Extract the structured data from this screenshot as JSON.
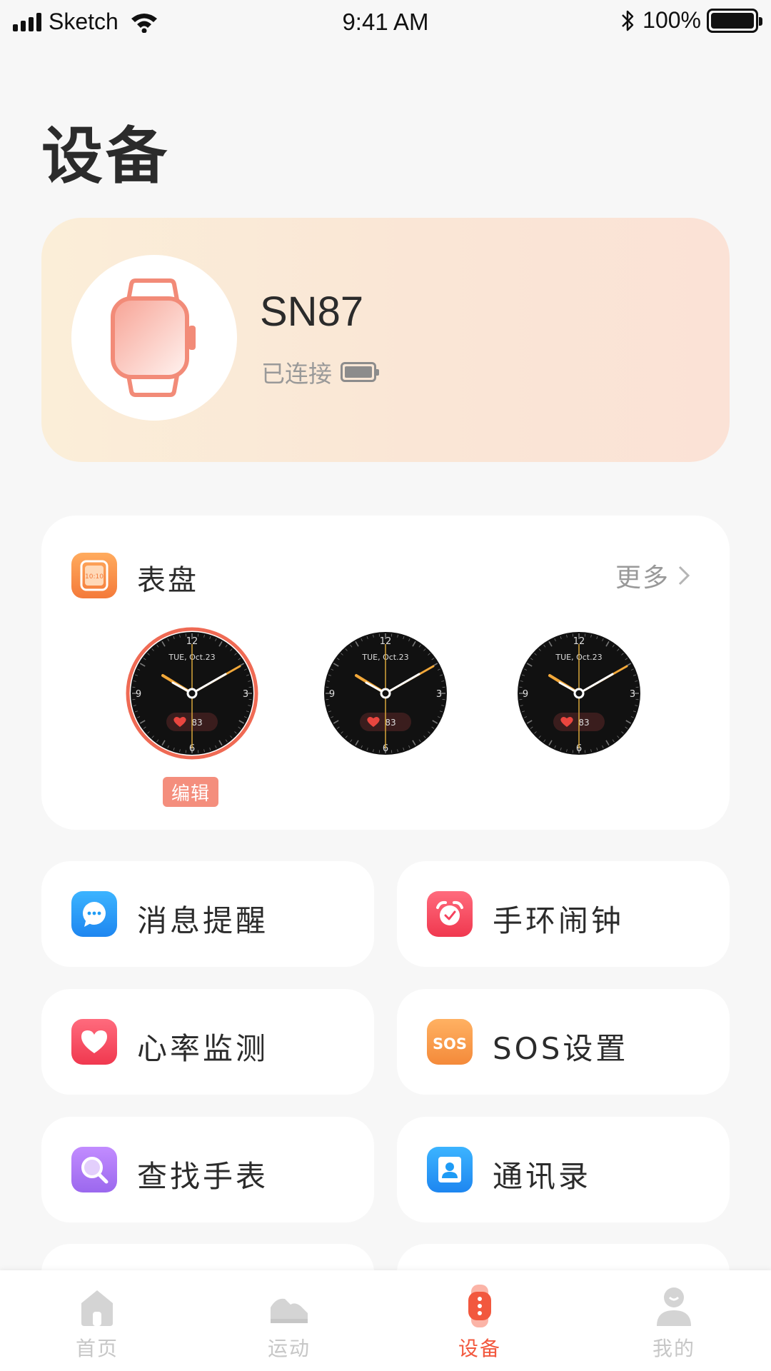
{
  "status_bar": {
    "carrier": "Sketch",
    "time": "9:41 AM",
    "battery_percent": "100%"
  },
  "page": {
    "title": "设备"
  },
  "device": {
    "name": "SN87",
    "status": "已连接",
    "battery_level": 1.0
  },
  "watch_faces": {
    "title": "表盘",
    "more_label": "更多",
    "edit_label": "编辑",
    "faces": [
      {
        "date": "TUE, Oct.23",
        "heart_rate": "83",
        "n12": "12",
        "n3": "3",
        "n6": "6",
        "n9": "9",
        "selected": true
      },
      {
        "date": "TUE, Oct.23",
        "heart_rate": "83",
        "n12": "12",
        "n3": "3",
        "n6": "6",
        "n9": "9",
        "selected": false
      },
      {
        "date": "TUE, Oct.23",
        "heart_rate": "83",
        "n12": "12",
        "n3": "3",
        "n6": "6",
        "n9": "9",
        "selected": false
      }
    ]
  },
  "features": [
    {
      "label": "消息提醒",
      "icon": "message-icon",
      "color": "#1e9bf5"
    },
    {
      "label": "手环闹钟",
      "icon": "alarm-icon",
      "color": "#f5415d"
    },
    {
      "label": "心率监测",
      "icon": "heart-icon",
      "color": "#f5415d"
    },
    {
      "label": "SOS设置",
      "icon": "sos-icon",
      "color": "#f7943e"
    },
    {
      "label": "查找手表",
      "icon": "search-icon",
      "color": "#a874f0"
    },
    {
      "label": "通讯录",
      "icon": "contacts-icon",
      "color": "#1e9bf5"
    }
  ],
  "tab_bar": {
    "active_color": "#f2583e",
    "tabs": [
      {
        "label": "首页",
        "icon": "home-icon"
      },
      {
        "label": "运动",
        "icon": "shoe-icon"
      },
      {
        "label": "设备",
        "icon": "band-icon",
        "active": true
      },
      {
        "label": "我的",
        "icon": "profile-icon"
      }
    ]
  }
}
